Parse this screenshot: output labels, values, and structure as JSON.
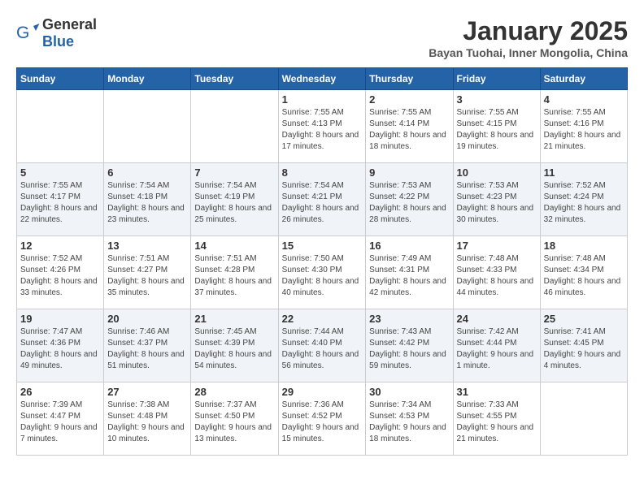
{
  "header": {
    "logo": {
      "general": "General",
      "blue": "Blue"
    },
    "title": "January 2025",
    "subtitle": "Bayan Tuohai, Inner Mongolia, China"
  },
  "days_of_week": [
    "Sunday",
    "Monday",
    "Tuesday",
    "Wednesday",
    "Thursday",
    "Friday",
    "Saturday"
  ],
  "weeks": [
    {
      "days": [
        {
          "empty": true
        },
        {
          "empty": true
        },
        {
          "empty": true
        },
        {
          "date": 1,
          "sunrise": "7:55 AM",
          "sunset": "4:13 PM",
          "daylight": "8 hours and 17 minutes."
        },
        {
          "date": 2,
          "sunrise": "7:55 AM",
          "sunset": "4:14 PM",
          "daylight": "8 hours and 18 minutes."
        },
        {
          "date": 3,
          "sunrise": "7:55 AM",
          "sunset": "4:15 PM",
          "daylight": "8 hours and 19 minutes."
        },
        {
          "date": 4,
          "sunrise": "7:55 AM",
          "sunset": "4:16 PM",
          "daylight": "8 hours and 21 minutes."
        }
      ]
    },
    {
      "days": [
        {
          "date": 5,
          "sunrise": "7:55 AM",
          "sunset": "4:17 PM",
          "daylight": "8 hours and 22 minutes."
        },
        {
          "date": 6,
          "sunrise": "7:54 AM",
          "sunset": "4:18 PM",
          "daylight": "8 hours and 23 minutes."
        },
        {
          "date": 7,
          "sunrise": "7:54 AM",
          "sunset": "4:19 PM",
          "daylight": "8 hours and 25 minutes."
        },
        {
          "date": 8,
          "sunrise": "7:54 AM",
          "sunset": "4:21 PM",
          "daylight": "8 hours and 26 minutes."
        },
        {
          "date": 9,
          "sunrise": "7:53 AM",
          "sunset": "4:22 PM",
          "daylight": "8 hours and 28 minutes."
        },
        {
          "date": 10,
          "sunrise": "7:53 AM",
          "sunset": "4:23 PM",
          "daylight": "8 hours and 30 minutes."
        },
        {
          "date": 11,
          "sunrise": "7:52 AM",
          "sunset": "4:24 PM",
          "daylight": "8 hours and 32 minutes."
        }
      ]
    },
    {
      "days": [
        {
          "date": 12,
          "sunrise": "7:52 AM",
          "sunset": "4:26 PM",
          "daylight": "8 hours and 33 minutes."
        },
        {
          "date": 13,
          "sunrise": "7:51 AM",
          "sunset": "4:27 PM",
          "daylight": "8 hours and 35 minutes."
        },
        {
          "date": 14,
          "sunrise": "7:51 AM",
          "sunset": "4:28 PM",
          "daylight": "8 hours and 37 minutes."
        },
        {
          "date": 15,
          "sunrise": "7:50 AM",
          "sunset": "4:30 PM",
          "daylight": "8 hours and 40 minutes."
        },
        {
          "date": 16,
          "sunrise": "7:49 AM",
          "sunset": "4:31 PM",
          "daylight": "8 hours and 42 minutes."
        },
        {
          "date": 17,
          "sunrise": "7:48 AM",
          "sunset": "4:33 PM",
          "daylight": "8 hours and 44 minutes."
        },
        {
          "date": 18,
          "sunrise": "7:48 AM",
          "sunset": "4:34 PM",
          "daylight": "8 hours and 46 minutes."
        }
      ]
    },
    {
      "days": [
        {
          "date": 19,
          "sunrise": "7:47 AM",
          "sunset": "4:36 PM",
          "daylight": "8 hours and 49 minutes."
        },
        {
          "date": 20,
          "sunrise": "7:46 AM",
          "sunset": "4:37 PM",
          "daylight": "8 hours and 51 minutes."
        },
        {
          "date": 21,
          "sunrise": "7:45 AM",
          "sunset": "4:39 PM",
          "daylight": "8 hours and 54 minutes."
        },
        {
          "date": 22,
          "sunrise": "7:44 AM",
          "sunset": "4:40 PM",
          "daylight": "8 hours and 56 minutes."
        },
        {
          "date": 23,
          "sunrise": "7:43 AM",
          "sunset": "4:42 PM",
          "daylight": "8 hours and 59 minutes."
        },
        {
          "date": 24,
          "sunrise": "7:42 AM",
          "sunset": "4:44 PM",
          "daylight": "9 hours and 1 minute."
        },
        {
          "date": 25,
          "sunrise": "7:41 AM",
          "sunset": "4:45 PM",
          "daylight": "9 hours and 4 minutes."
        }
      ]
    },
    {
      "days": [
        {
          "date": 26,
          "sunrise": "7:39 AM",
          "sunset": "4:47 PM",
          "daylight": "9 hours and 7 minutes."
        },
        {
          "date": 27,
          "sunrise": "7:38 AM",
          "sunset": "4:48 PM",
          "daylight": "9 hours and 10 minutes."
        },
        {
          "date": 28,
          "sunrise": "7:37 AM",
          "sunset": "4:50 PM",
          "daylight": "9 hours and 13 minutes."
        },
        {
          "date": 29,
          "sunrise": "7:36 AM",
          "sunset": "4:52 PM",
          "daylight": "9 hours and 15 minutes."
        },
        {
          "date": 30,
          "sunrise": "7:34 AM",
          "sunset": "4:53 PM",
          "daylight": "9 hours and 18 minutes."
        },
        {
          "date": 31,
          "sunrise": "7:33 AM",
          "sunset": "4:55 PM",
          "daylight": "9 hours and 21 minutes."
        },
        {
          "empty": true
        }
      ]
    }
  ]
}
